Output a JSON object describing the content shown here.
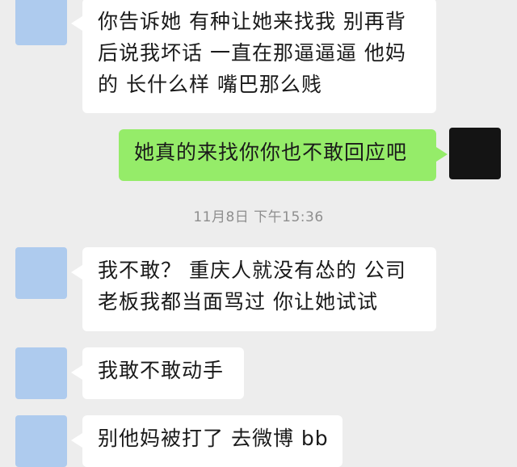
{
  "messages": [
    {
      "side": "incoming",
      "lines": [
        "你告诉她 有种让她来找我 别再背",
        "后说我坏话 一直在那逼逼逼 他妈",
        "的 长什么样 嘴巴那么贱"
      ]
    },
    {
      "side": "outgoing",
      "lines": [
        "她真的来找你你也不敢回应吧"
      ]
    },
    {
      "side": "incoming",
      "lines": [
        "我不敢？ 重庆人就没有怂的 公司",
        "老板我都当面骂过 你让她试试"
      ]
    },
    {
      "side": "incoming",
      "lines": [
        "我敢不敢动手"
      ]
    },
    {
      "side": "incoming",
      "lines": [
        "别他妈被打了 去微博 bb"
      ]
    }
  ],
  "timestamp": "11月8日 下午15:36",
  "colors": {
    "background": "#ededed",
    "incoming_bubble": "#ffffff",
    "outgoing_bubble": "#95ec69",
    "avatar_placeholder": "#aecbee",
    "own_avatar": "#141414"
  }
}
